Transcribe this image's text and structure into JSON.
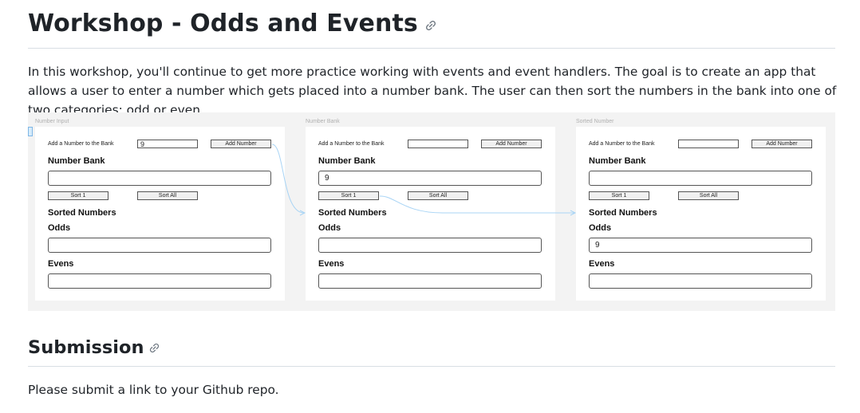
{
  "heading": {
    "title": "Workshop - Odds and Events"
  },
  "intro_text": "In this workshop, you'll continue to get more practice working with events and event handlers. The goal is to create an app that allows a user to enter a number which gets placed into a number bank. The user can then sort the numbers in the bank into one of two categories: odd or even.",
  "figure": {
    "frames": [
      {
        "title": "Number Input",
        "add_label": "Add a Number to the Bank",
        "input_value": "9",
        "add_button": "Add Number",
        "bank_label": "Number Bank",
        "bank_value": "",
        "sort_one": "Sort 1",
        "sort_all": "Sort All",
        "sorted_label": "Sorted Numbers",
        "odds_label": "Odds",
        "odds_value": "",
        "evens_label": "Evens",
        "evens_value": ""
      },
      {
        "title": "Number Bank",
        "add_label": "Add a Number to the Bank",
        "input_value": "",
        "add_button": "Add Number",
        "bank_label": "Number Bank",
        "bank_value": "9",
        "sort_one": "Sort 1",
        "sort_all": "Sort All",
        "sorted_label": "Sorted Numbers",
        "odds_label": "Odds",
        "odds_value": "",
        "evens_label": "Evens",
        "evens_value": ""
      },
      {
        "title": "Sorted Number",
        "add_label": "Add a Number to the Bank",
        "input_value": "",
        "add_button": "Add Number",
        "bank_label": "Number Bank",
        "bank_value": "",
        "sort_one": "Sort 1",
        "sort_all": "Sort All",
        "sorted_label": "Sorted Numbers",
        "odds_label": "Odds",
        "odds_value": "9",
        "evens_label": "Evens",
        "evens_value": ""
      }
    ]
  },
  "submission": {
    "title": "Submission",
    "text": "Please submit a link to your Github repo."
  },
  "colors": {
    "arrow": "#a8d4f5",
    "figure_bg": "#f3f3f3"
  },
  "icons": {
    "anchor": "link-icon"
  }
}
